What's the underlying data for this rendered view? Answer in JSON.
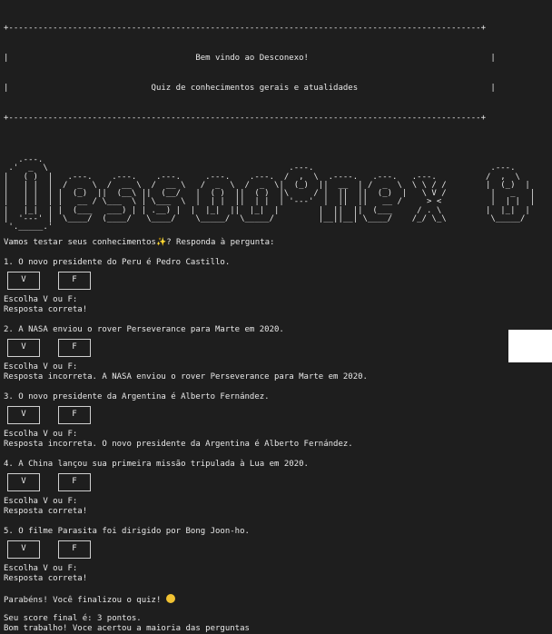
{
  "banner": {
    "top": "+------------------------------------------------------------------------------------------------+",
    "line1": "|                                      Bem vindo ao Desconexo!                                     |",
    "line2": "|                             Quiz de conhecimentos gerais e atualidades                           |",
    "bottom": "+------------------------------------------------------------------------------------------------+"
  },
  "ascii_logo": [
    "   .---.                                                                                                    ",
    " .'  _  \\                                                 .---.                                    .---.    ",
    "|   ( )  |   .---.    .---.    .---.     .---.    .---.  /  ,  \\  .----.   .---.   .---.          /  ,  \\   ",
    "|   | |  |  /  _  \\  /  __ \\  /  __ \\   /  _  \\  /  _  \\|  (_)  ||  __  | /  _  \\  \\ \\ / /        |  (_)  |  ",
    "|   | |  | |  (_)  ||  (__\\ ||  (__/   |  ( )  ||  ( )  |\\     / |  ||  ||  (_)  |   \\ V /         |   _   |  ",
    "|   | |  | |   __ / \\___  \\ | \\___  \\  |  | |  ||  | |  | '---'  |  ||  ||   __ /     > <          |  | |  |  ",
    "|   |_|  | |  (___   ___) | | .__) |  |  |_|  ||  |_|  |        |  ||  ||  (___     / . \\         |  |_|  |  ",
    "|  '---' |  \\____/  (____/   \\____/    \\_____/  \\_____/         |__||__| \\____/    /_/ \\_\\         \\_____/   ",
    " '._____.'                                                                                                  "
  ],
  "intro": "Vamos testar seus conhecimentos",
  "intro_tail": "? Responda à pergunta:",
  "button_v": "V",
  "button_f": "F",
  "prompt": "Escolha V ou F:",
  "questions": [
    {
      "q": "1. O novo presidente do Peru é Pedro Castillo.",
      "result": "Resposta correta!"
    },
    {
      "q": "2. A NASA enviou o rover Perseverance para Marte em 2020.",
      "result": "Resposta incorreta. A NASA enviou o rover Perseverance para Marte em 2020."
    },
    {
      "q": "3. O novo presidente da Argentina é Alberto Fernández.",
      "result": "Resposta incorreta. O novo presidente da Argentina é Alberto Fernández."
    },
    {
      "q": "4. A China lançou sua primeira missão tripulada à Lua em 2020.",
      "result": "Resposta correta!"
    },
    {
      "q": "5. O filme Parasita foi dirigido por Bong Joon-ho.",
      "result": "Resposta correta!"
    }
  ],
  "finish": "Parabéns! Você finalizou o quiz! ",
  "score": "Seu score final é: 3 pontos.",
  "verdict": "Bom trabalho! Voce acertou a maioria das perguntas",
  "icons": {
    "sparkles": "sparkles-icon",
    "emoji": "smiling-face-icon"
  },
  "colors": {
    "background": "#1e1e1e",
    "text": "#e8e8e8"
  }
}
